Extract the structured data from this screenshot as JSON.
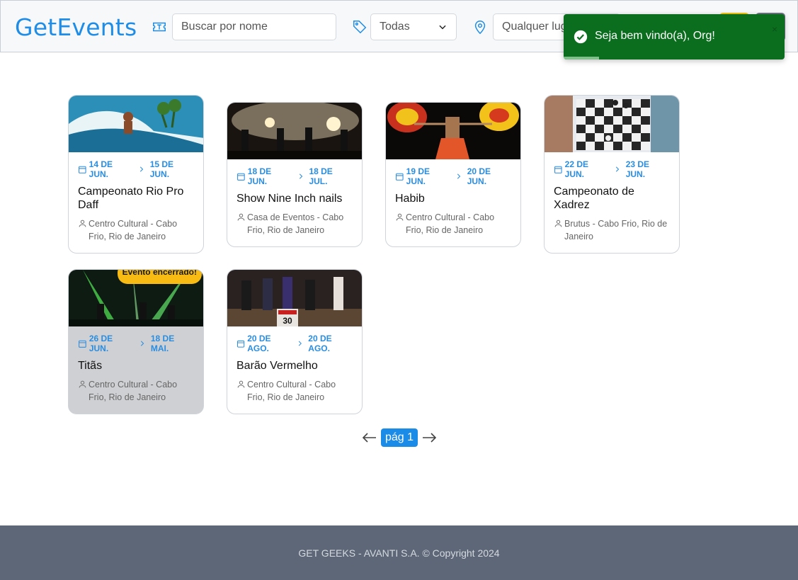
{
  "header": {
    "logo": "GetEvents",
    "search": {
      "placeholder": "Buscar por nome"
    },
    "category": {
      "value": "Todas"
    },
    "location": {
      "placeholder": "Qualquer lugar"
    }
  },
  "toast": {
    "message": "Seja bem vindo(a), Org!",
    "close": "×",
    "progress": 0.16
  },
  "events": [
    {
      "start": "14 DE JUN.",
      "end": "15 DE JUN.",
      "title": "Campeonato Rio Pro Daff",
      "location": "Centro Cultural - Cabo Frio, Rio de Janeiro",
      "image": "surf"
    },
    {
      "start": "18 DE JUN.",
      "end": "18 DE JUL.",
      "title": "Show Nine Inch nails",
      "location": "Casa de Eventos - Cabo Frio, Rio de Janeiro",
      "image": "concert"
    },
    {
      "start": "19 DE JUN.",
      "end": "20 DE JUN.",
      "title": "Habib",
      "location": "Centro Cultural - Cabo Frio, Rio de Janeiro",
      "image": "dancer"
    },
    {
      "start": "22 DE JUN.",
      "end": "23 DE JUN.",
      "title": "Campeonato de Xadrez",
      "location": "Brutus - Cabo Frio, Rio de Janeiro",
      "image": "chess"
    },
    {
      "start": "26 DE JUN.",
      "end": "18 DE MAI.",
      "title": "Titãs",
      "location": "Centro Cultural - Cabo Frio, Rio de Janeiro",
      "image": "band-green",
      "badge": "Evento encerrado!"
    },
    {
      "start": "20 DE AGO.",
      "end": "20 DE AGO.",
      "title": "Barão Vermelho",
      "location": "Centro Cultural - Cabo Frio, Rio de Janeiro",
      "image": "band-stage",
      "sign": "30"
    }
  ],
  "pagination": {
    "label": "pág 1"
  },
  "footer": {
    "text": "GET GEEKS - AVANTI S.A. © Copyright 2024"
  },
  "colors": {
    "accent": "#1a8be7",
    "toast": "#0b6e1e",
    "badge": "#f7bb13",
    "footer": "#5d6777"
  }
}
